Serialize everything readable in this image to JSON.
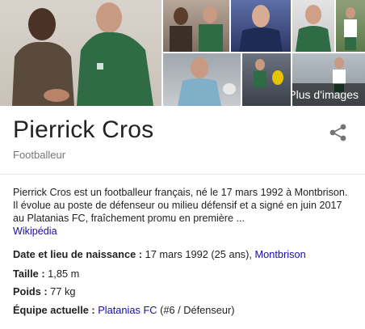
{
  "images": {
    "more_label": "Plus d'images"
  },
  "header": {
    "title": "Pierrick Cros",
    "subtitle": "Footballeur",
    "share_icon": "share-icon"
  },
  "description": {
    "text": "Pierrick Cros est un footballeur français, né le 17 mars 1992 à Montbrison. Il évolue au poste de défenseur ou milieu défensif et a signé en juin 2017 au Platanias FC, fraîchement promu en première ...",
    "source_link": "Wikipédia"
  },
  "facts": {
    "birth": {
      "label": "Date et lieu de naissance",
      "value": "17 mars 1992 (25 ans),",
      "link": "Montbrison"
    },
    "height": {
      "label": "Taille",
      "value": "1,85 m"
    },
    "weight": {
      "label": "Poids",
      "value": "77 kg"
    },
    "team": {
      "label": "Équipe actuelle",
      "link": "Platanias FC",
      "value": "(#6 / Défenseur)"
    },
    "separator": " : "
  },
  "colors": {
    "link": "#1a0dab",
    "text": "#222222",
    "muted": "#777777",
    "divider": "#e6e6e6"
  }
}
